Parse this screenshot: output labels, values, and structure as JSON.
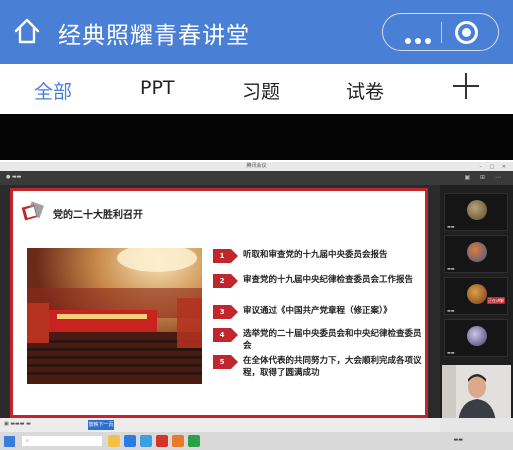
{
  "header": {
    "title": "经典照耀青春讲堂",
    "home_icon": "home-icon",
    "more_icon": "more-dots-icon",
    "close_icon": "close-circle-icon",
    "bg_color": "#4a7fd6"
  },
  "tabs": [
    {
      "label": "全部",
      "active": true
    },
    {
      "label": "PPT",
      "active": false
    },
    {
      "label": "习题",
      "active": false
    },
    {
      "label": "试卷",
      "active": false
    }
  ],
  "add_tab_icon": "plus-icon",
  "meeting": {
    "window_title": "腾讯会议",
    "slide": {
      "title": "党的二十大胜利召开",
      "agenda": [
        {
          "num": "1",
          "text": "听取和审查党的十九届中央委员会报告"
        },
        {
          "num": "2",
          "text": "审查党的十九届中央纪律检查委员会工作报告"
        },
        {
          "num": "3",
          "text": "审议通过《中国共产党章程（修正案）》"
        },
        {
          "num": "4",
          "text": "选举党的二十届中央委员会和中央纪律检查委员会"
        },
        {
          "num": "5",
          "text": "在全体代表的共同努力下，大会顺利完成各项议程，取得了圆满成功"
        }
      ],
      "accent_color": "#c0272d"
    },
    "participant_badge": "正在讲解",
    "taskbar_blue_label": "放映下一页"
  }
}
